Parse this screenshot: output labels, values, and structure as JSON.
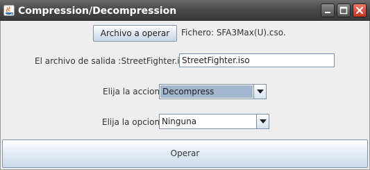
{
  "window": {
    "title": "Compression/Decompression",
    "app_icon": "java-icon",
    "controls": [
      "minimize-icon",
      "maximize-icon",
      "close-icon"
    ],
    "close_color": "#d9442b"
  },
  "file": {
    "button_label": "Archivo a operar",
    "fichero_text": "Fichero: SFA3Max(U).cso."
  },
  "output": {
    "label": "El archivo de salida :StreetFighter.iso",
    "value": "StreetFighter.iso"
  },
  "accion": {
    "label": "Elija la accion",
    "selected": "Decompress",
    "highlight_color": "#a3b6cf"
  },
  "opcion": {
    "label": "Elija la opcion",
    "selected": "Ninguna"
  },
  "operar": {
    "label": "Operar"
  }
}
